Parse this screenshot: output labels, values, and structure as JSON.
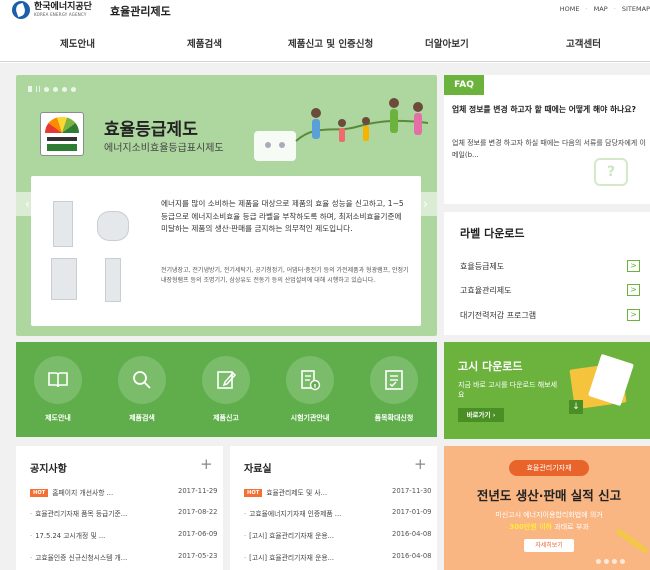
{
  "header": {
    "logo_kr": "한국에너지공단",
    "logo_en": "KOREA ENERGY AGENCY",
    "site_title": "효율관리제도",
    "util_links": [
      "HOME",
      "MAP",
      "SITEMAP"
    ]
  },
  "nav": [
    "제도안내",
    "제품검색",
    "제품신고 및 인증신청",
    "더알아보기",
    "고객센터"
  ],
  "hero": {
    "title": "효율등급제도",
    "subtitle": "에너지소비효율등급표시제도",
    "description": "에너지를 많이 소비하는 제품을 대상으로 제품의 효율 성능을 신고하고, 1~5등급으로 에너지소비효율 등급 라벨을 부착하도록 하며, 최저소비효율기준에 미달하는 제품의 생산·판매를 금지하는 의무적인 제도입니다.",
    "note": "전기냉장고, 전기냉방기, 전기세탁기, 공기청정기, 어댑터·충전기 등의 가전제품과 형광램프, 안정기 내장형램프 등의 조명기기, 삼상유도 전동기 등의 산업설비에 대해 시행하고 있습니다.",
    "prev_arrow": "‹",
    "next_arrow": "›"
  },
  "faq": {
    "label": "FAQ",
    "question": "업체 정보를 변경 하고자 할 때에는 어떻게 해야 하나요?",
    "answer": "업체 정보를 변경 하고자 하실 때에는 다음의 서류를 담당자에게 이메일(b...",
    "bubble": "?"
  },
  "label_download": {
    "title": "라벨 다운로드",
    "arrow": ">",
    "items": [
      "효율등급제도",
      "고효율관리제도",
      "대기전력저감 프로그램"
    ]
  },
  "quick_menu": [
    "제도안내",
    "제품검색",
    "제품신고",
    "시험기관안내",
    "품목확대신청"
  ],
  "notice_download": {
    "title": "고시 다운로드",
    "subtitle": "지금 바로 고시를 다운로드 해보세요",
    "button": "바로가기 ›",
    "icon": "↓"
  },
  "notices": {
    "title": "공지사항",
    "plus": "+",
    "hot_label": "HOT",
    "rows": [
      {
        "text": "홈페이지 개선사항 ...",
        "date": "2017-11-29",
        "hot": true
      },
      {
        "text": "효율관리기자재 품목 등급기준...",
        "date": "2017-08-22",
        "hot": false
      },
      {
        "text": "17.5.24 고시개정 및 ...",
        "date": "2017-06-09",
        "hot": false
      },
      {
        "text": "고효율인증 신규신청시스템 개...",
        "date": "2017-05-23",
        "hot": false
      }
    ]
  },
  "resources": {
    "title": "자료실",
    "plus": "+",
    "hot_label": "HOT",
    "rows": [
      {
        "text": "효율관리제도 및 사...",
        "date": "2017-11-30",
        "hot": true
      },
      {
        "text": "고효율에너지기자재 인증제품 ...",
        "date": "2017-01-09",
        "hot": false
      },
      {
        "text": "[고시] 효율관리기자재 운용...",
        "date": "2016-04-08",
        "hot": false
      },
      {
        "text": "[고시] 효율관리기자재 운용...",
        "date": "2016-04-08",
        "hot": false
      }
    ]
  },
  "promo": {
    "tag": "효율관리기자재",
    "title": "전년도 생산·판매 실적 신고",
    "line1": "미신고시 에너지이용합리화법에 의거",
    "line2_highlight": "300만원 이하",
    "line2_rest": " 과태료 부과",
    "button": "자세히보기"
  }
}
